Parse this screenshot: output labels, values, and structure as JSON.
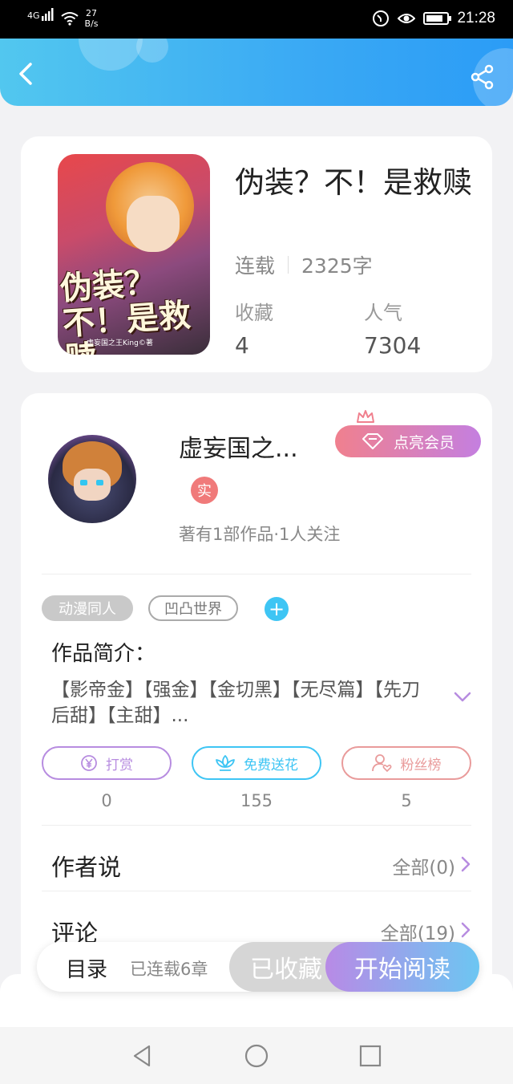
{
  "status_bar": {
    "network": "4G",
    "speed_value": "27",
    "speed_unit": "B/s",
    "time": "21:28"
  },
  "book": {
    "cover_title": "伪装？不！是救赎",
    "cover_author": "虚妄国之王King©著",
    "title": "伪装？不！是救赎",
    "status": "连载",
    "word_count": "2325字",
    "favorites_label": "收藏",
    "favorites_value": "4",
    "popularity_label": "人气",
    "popularity_value": "7304"
  },
  "author": {
    "name": "虚妄国之...",
    "vip_label": "点亮会员",
    "verified_badge": "实",
    "stats": "著有1部作品·1人关注"
  },
  "tags": [
    "动漫同人",
    "凹凸世界"
  ],
  "tag_add": "+",
  "intro": {
    "heading": "作品简介：",
    "text": "【影帝金】【强金】【金切黑】【无尽篇】【先刀后甜】【主甜】..."
  },
  "actions": {
    "reward_label": "打赏",
    "reward_count": "0",
    "flower_label": "免费送花",
    "flower_count": "155",
    "fans_label": "粉丝榜",
    "fans_count": "5"
  },
  "author_says": {
    "title": "作者说",
    "link": "全部(0)"
  },
  "comments": {
    "title": "评论",
    "link": "全部(19)"
  },
  "bottom_bar": {
    "toc": "目录",
    "chapter_status": "已连载6章",
    "collected": "已收藏",
    "start_reading": "开始阅读"
  },
  "colors": {
    "header_start": "#52c7ef",
    "header_end": "#2b9cf6",
    "vip_start": "#f0808e",
    "vip_end": "#c47fe0",
    "read_start": "#b88ae6",
    "read_end": "#6cc6f2"
  }
}
